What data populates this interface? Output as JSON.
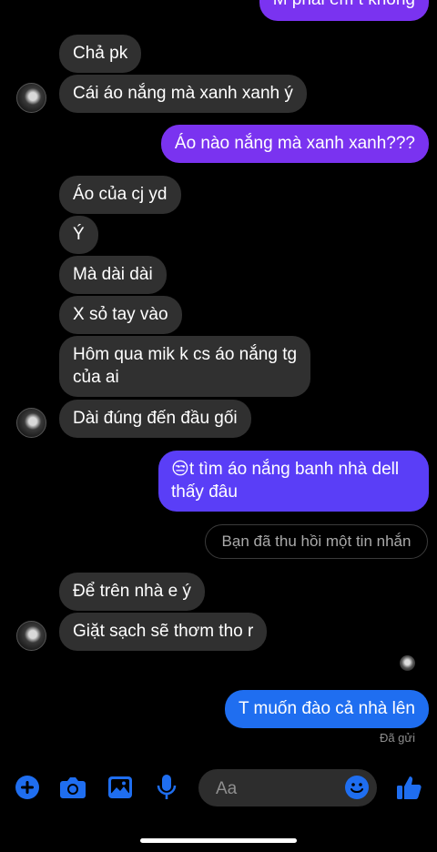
{
  "messages": {
    "top_partial": "M phải em t không",
    "m1": "Chả pk",
    "m2": "Cái áo nắng mà xanh xanh ý",
    "m3": "Áo nào nắng mà xanh xanh???",
    "m4": "Áo của cj yd",
    "m5": "Ý",
    "m6": "Mà dài dài",
    "m7": "X sỏ tay vào",
    "m8_line1": "Hôm qua mik k cs áo nắng tg",
    "m8_line2": "của ai",
    "m9": "Dài đúng đến đầu gối",
    "m10_emoji": "😒",
    "m10_line1": "t tìm áo nắng banh nhà dell",
    "m10_line2": "thấy đâu",
    "recall": "Bạn đã thu hồi một tin nhắn",
    "m11": "Để trên nhà e ý",
    "m12": "Giặt sạch sẽ thơm tho r",
    "m13": "T muốn đào cả nhà lên",
    "status": "Đã gửi"
  },
  "composer": {
    "placeholder": "Aa"
  },
  "icons": [
    "plus-icon",
    "camera-icon",
    "image-icon",
    "mic-icon",
    "emoji-icon",
    "like-icon"
  ],
  "colors": {
    "accent": "#1f6ef0",
    "incoming": "#303030",
    "outgoing_purple": "#7a33f0"
  }
}
